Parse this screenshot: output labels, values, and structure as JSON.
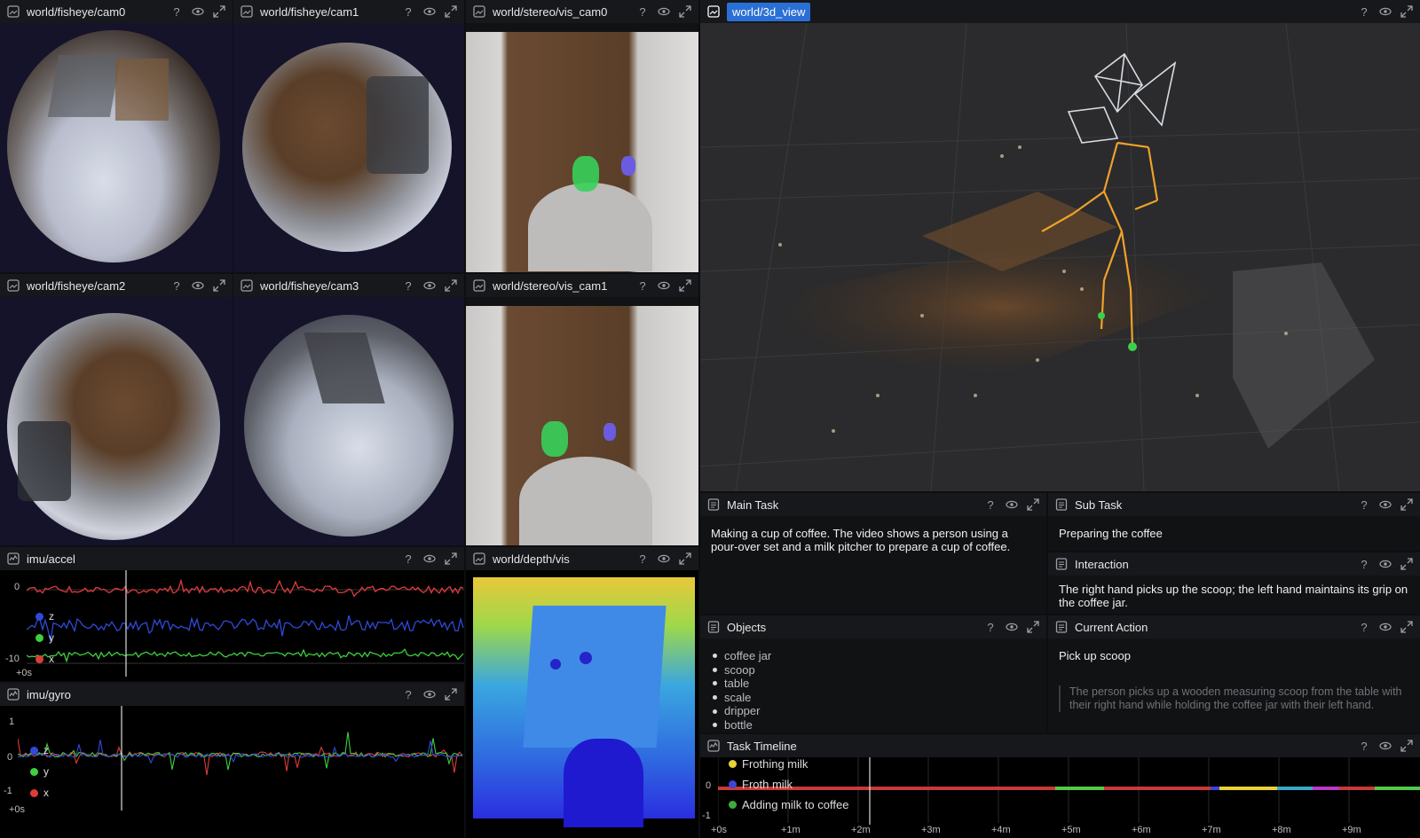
{
  "panels": {
    "fisheye_cam0": {
      "title": "world/fisheye/cam0"
    },
    "fisheye_cam1": {
      "title": "world/fisheye/cam1"
    },
    "stereo_cam0": {
      "title": "world/stereo/vis_cam0"
    },
    "view3d": {
      "title": "world/3d_view"
    },
    "fisheye_cam2": {
      "title": "world/fisheye/cam2"
    },
    "fisheye_cam3": {
      "title": "world/fisheye/cam3"
    },
    "stereo_cam1": {
      "title": "world/stereo/vis_cam1"
    },
    "imu_accel": {
      "title": "imu/accel",
      "y_ticks": [
        "0",
        "-10"
      ],
      "x_tick": "+0s",
      "legend": [
        {
          "label": "z",
          "color": "#2f4ad8"
        },
        {
          "label": "y",
          "color": "#3ecf3e"
        },
        {
          "label": "x",
          "color": "#e03b3b"
        }
      ]
    },
    "imu_gyro": {
      "title": "imu/gyro",
      "y_ticks": [
        "1",
        "0",
        "-1"
      ],
      "x_tick": "+0s",
      "legend": [
        {
          "label": "z",
          "color": "#2f4ad8"
        },
        {
          "label": "y",
          "color": "#3ecf3e"
        },
        {
          "label": "x",
          "color": "#e03b3b"
        }
      ]
    },
    "depth": {
      "title": "world/depth/vis"
    },
    "main_task": {
      "title": "Main Task",
      "text": "Making a cup of coffee. The video shows a person using a pour-over set and a milk pitcher to prepare a cup of coffee."
    },
    "sub_task": {
      "title": "Sub Task",
      "text": "Preparing the coffee"
    },
    "interaction": {
      "title": "Interaction",
      "text": "The right hand picks up the scoop; the left hand maintains its grip on the coffee jar."
    },
    "objects": {
      "title": "Objects",
      "items": [
        "coffee jar",
        "scoop",
        "table",
        "scale",
        "dripper",
        "bottle"
      ]
    },
    "current_action": {
      "title": "Current Action",
      "text": "Pick up scoop",
      "description": "The person picks up a wooden measuring scoop from the table with their right hand while holding the coffee jar with their left hand."
    },
    "task_timeline": {
      "title": "Task Timeline",
      "y_tick_zero": "0",
      "y_tick_neg": "-1",
      "legend": [
        {
          "label": "Frothing milk",
          "color": "#e8d23a"
        },
        {
          "label": "Froth milk",
          "color": "#3b45d8"
        },
        {
          "label": "Adding milk to coffee",
          "color": "#3eaa3e"
        }
      ],
      "x_ticks": [
        "+0s",
        "+1m",
        "+2m",
        "+3m",
        "+4m",
        "+5m",
        "+6m",
        "+7m",
        "+8m",
        "+9m"
      ]
    }
  },
  "colors": {
    "accent": "#2a6fd6",
    "panel_bg": "#111214",
    "header_bg": "#17181b"
  }
}
